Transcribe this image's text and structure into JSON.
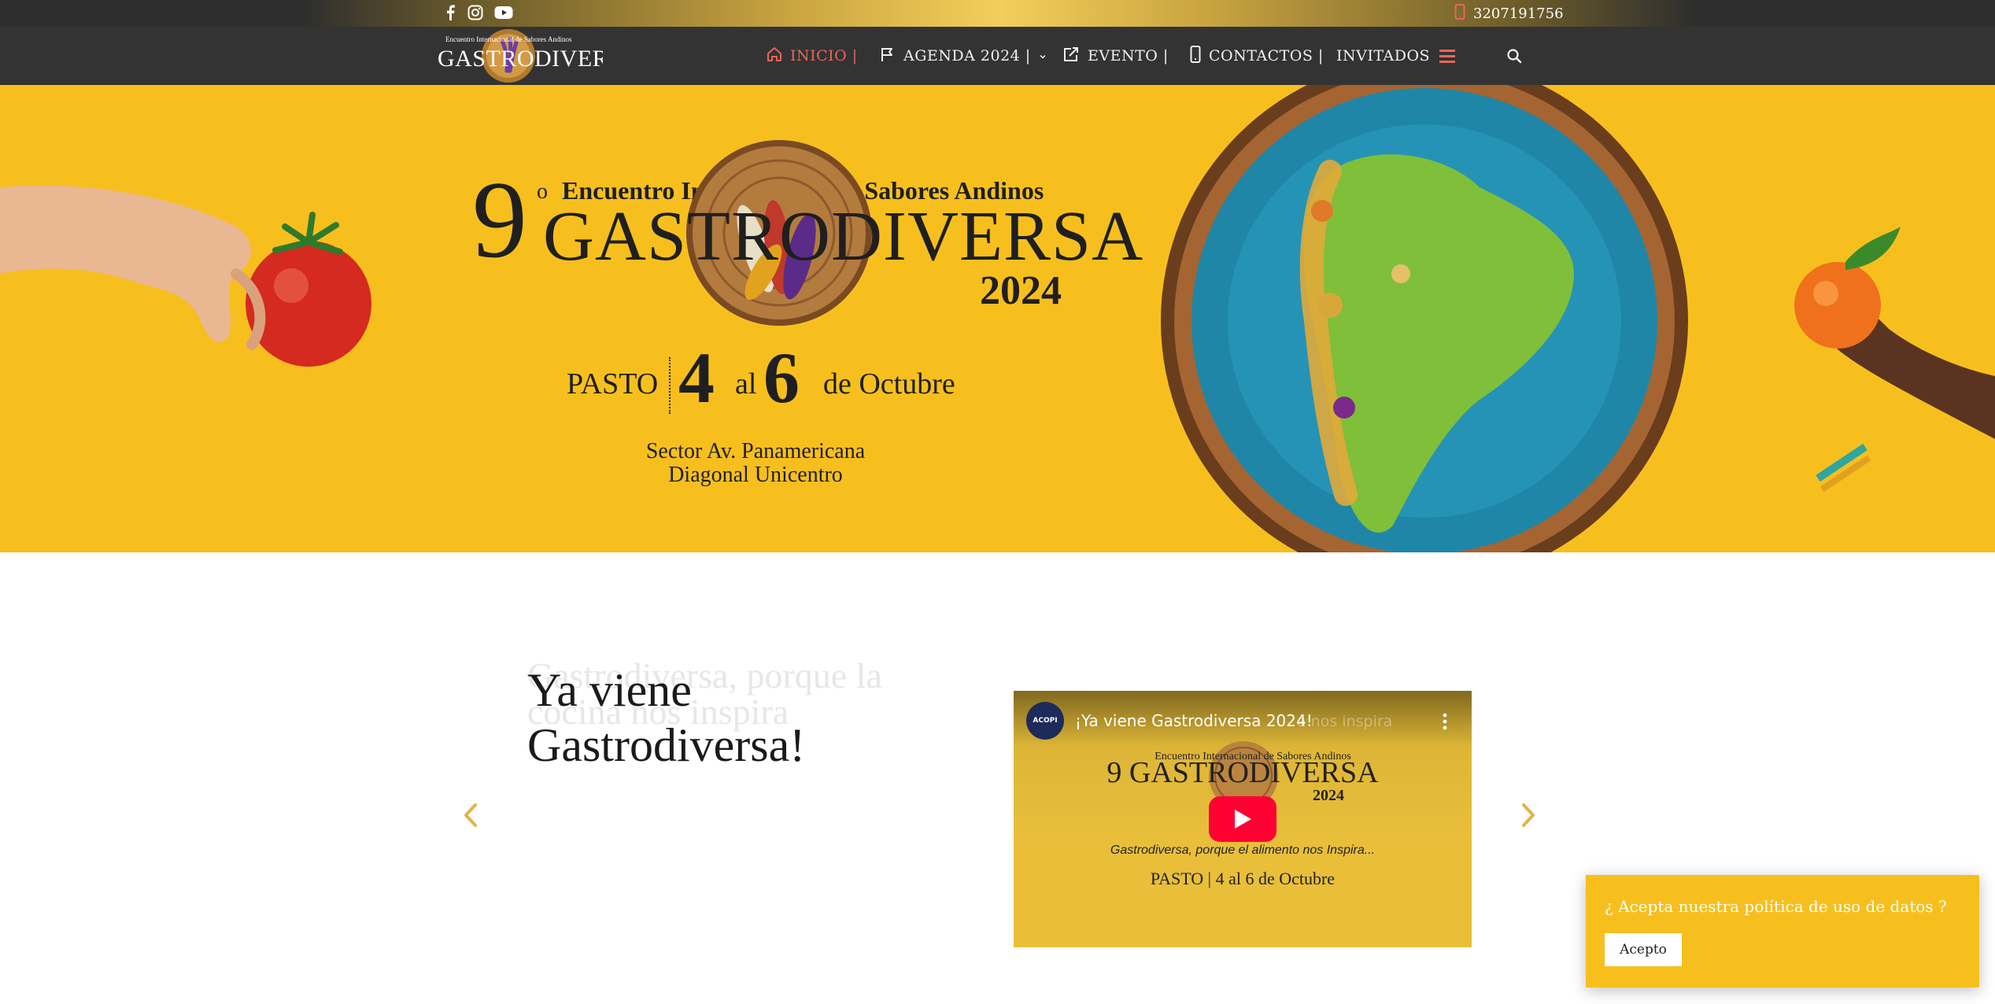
{
  "topbar": {
    "phone": "3207191756",
    "icons": [
      "facebook-icon",
      "instagram-icon",
      "youtube-icon",
      "phone-icon"
    ]
  },
  "logo": {
    "small": "Encuentro Internacional de Sabores Andinos",
    "main": "GASTRODIVERSA"
  },
  "nav": {
    "items": [
      {
        "label": "INICIO |",
        "icon": "home-icon"
      },
      {
        "label": "AGENDA 2024 |",
        "icon": "flag-icon"
      },
      {
        "label": "EVENTO |",
        "icon": "share-icon"
      },
      {
        "label": "CONTACTOS |",
        "icon": "mobile-icon"
      },
      {
        "label": "INVITADOS"
      }
    ],
    "active_color": "#e4685a"
  },
  "hero": {
    "nine": "9",
    "superscript": "o",
    "subtitle": "Encuentro Internacional de Sabores Andinos",
    "title": "GASTRODIVERSA",
    "year": "2024",
    "city": "PASTO",
    "day_start": "4",
    "al": "al",
    "day_end": "6",
    "month": "de Octubre",
    "place_line1": "Sector Av. Panamericana",
    "place_line2": "Diagonal Unicentro",
    "background": "#f7bf1e"
  },
  "content": {
    "ghost_text": "Gastrodiversa, porque la cocina nos inspira",
    "heading": "Ya viene Gastrodiversa!"
  },
  "video": {
    "channel": "ACOPI",
    "title": "¡Ya viene Gastrodiversa 2024!",
    "title_ghost": "a nos inspira",
    "logo_sub": "Encuentro Internacional de Sabores Andinos",
    "logo": "9 GASTRODIVERSA",
    "year": "2024",
    "tagline": "Gastrodiversa, porque el alimento nos Inspira...",
    "date": "PASTO | 4 al 6 de Octubre"
  },
  "cookie": {
    "question": "¿ Acepta nuestra política de uso de datos ?",
    "button": "Acepto",
    "background": "#f7bf1e"
  },
  "colors": {
    "nav_bg": "#333333",
    "accent": "#f7bf1e",
    "arrow": "#e2b34c"
  }
}
